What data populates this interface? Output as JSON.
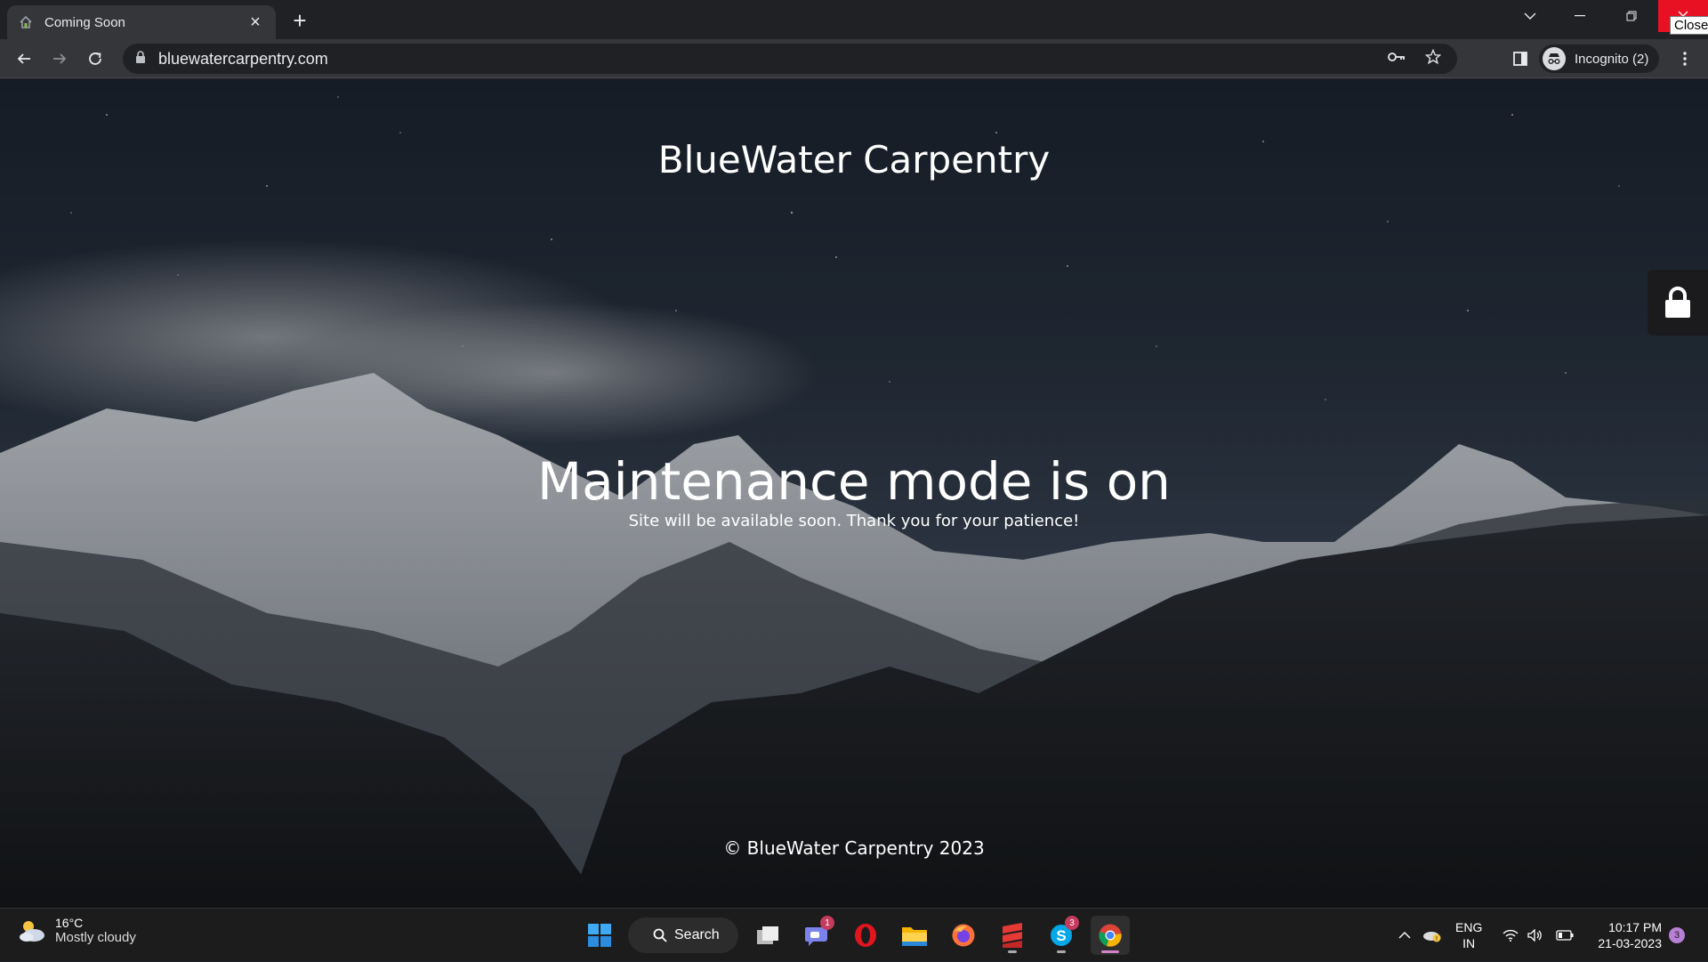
{
  "browser": {
    "tab": {
      "title": "Coming Soon",
      "close_icon": "close-icon"
    },
    "new_tab_label": "+",
    "tooltip": "Close",
    "address": "bluewatercarpentry.com",
    "incognito_label": "Incognito (2)"
  },
  "page": {
    "site_title": "BlueWater Carpentry",
    "heading": "Maintenance mode is on",
    "subtext": "Site will be available soon. Thank you for your patience!",
    "footer": "© BlueWater Carpentry 2023"
  },
  "taskbar": {
    "weather": {
      "temp": "16°C",
      "condition": "Mostly cloudy"
    },
    "search_label": "Search",
    "apps": [
      {
        "name": "start",
        "badge": ""
      },
      {
        "name": "task-view",
        "badge": ""
      },
      {
        "name": "teams",
        "badge": "1"
      },
      {
        "name": "opera",
        "badge": ""
      },
      {
        "name": "file-explorer",
        "badge": ""
      },
      {
        "name": "firefox",
        "badge": ""
      },
      {
        "name": "sublime",
        "badge": ""
      },
      {
        "name": "skype",
        "badge": "3"
      },
      {
        "name": "chrome",
        "badge": ""
      }
    ],
    "lang_line1": "ENG",
    "lang_line2": "IN",
    "time": "10:17 PM",
    "date": "21-03-2023",
    "notifications": "3"
  }
}
